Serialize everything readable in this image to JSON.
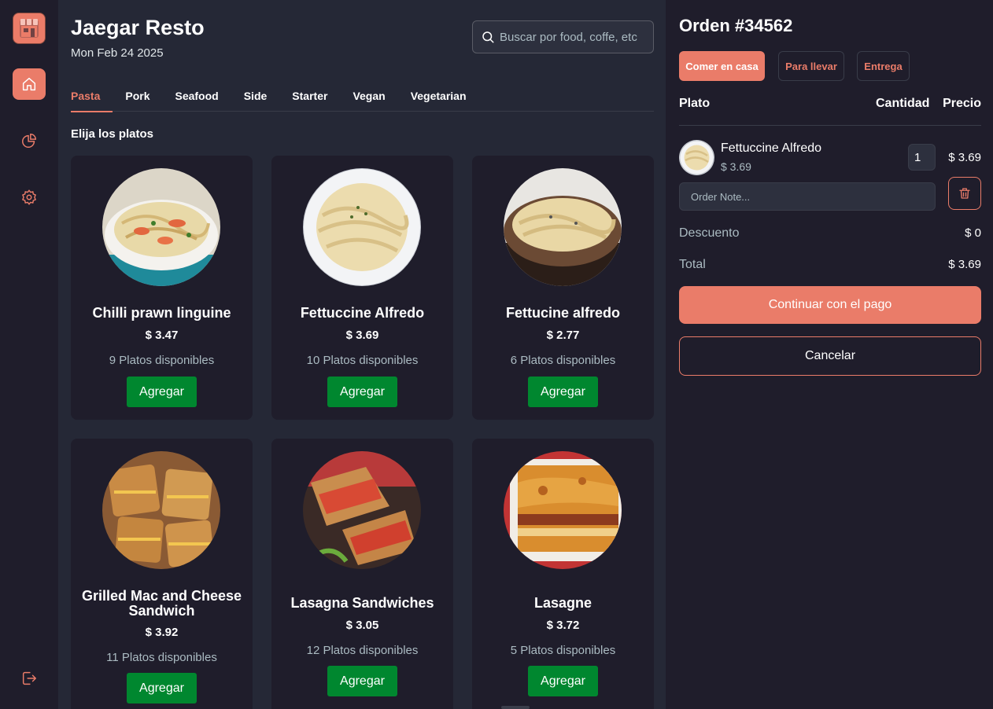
{
  "app": {
    "title": "Jaegar Resto",
    "date": "Mon Feb 24 2025"
  },
  "colors": {
    "accent": "#ea7c69",
    "add_button": "#00872f",
    "panel": "#1f1d2b",
    "background": "#252836"
  },
  "sidebar": {
    "items": [
      {
        "icon": "home-icon",
        "active": true
      },
      {
        "icon": "pie-chart-icon",
        "active": false
      },
      {
        "icon": "gear-icon",
        "active": false
      },
      {
        "icon": "logout-icon",
        "active": false
      }
    ]
  },
  "search": {
    "placeholder": "Buscar por food, coffe, etc",
    "icon": "search-icon"
  },
  "tabs": [
    {
      "label": "Pasta",
      "active": true
    },
    {
      "label": "Pork",
      "active": false
    },
    {
      "label": "Seafood",
      "active": false
    },
    {
      "label": "Side",
      "active": false
    },
    {
      "label": "Starter",
      "active": false
    },
    {
      "label": "Vegan",
      "active": false
    },
    {
      "label": "Vegetarian",
      "active": false
    }
  ],
  "menu": {
    "section_title": "Elija los platos",
    "add_label": "Agregar",
    "dishes": [
      {
        "name": "Chilli prawn linguine",
        "price": "$ 3.47",
        "stock": "9 Platos disponibles"
      },
      {
        "name": "Fettuccine Alfredo",
        "price": "$ 3.69",
        "stock": "10 Platos disponibles"
      },
      {
        "name": "Fettucine alfredo",
        "price": "$ 2.77",
        "stock": "6 Platos disponibles"
      },
      {
        "name": "Grilled Mac and Cheese Sandwich",
        "price": "$ 3.92",
        "stock": "11 Platos disponibles"
      },
      {
        "name": "Lasagna Sandwiches",
        "price": "$ 3.05",
        "stock": "12 Platos disponibles"
      },
      {
        "name": "Lasagne",
        "price": "$ 3.72",
        "stock": "5 Platos disponibles"
      }
    ]
  },
  "order": {
    "title": "Orden #34562",
    "types": [
      {
        "label": "Comer en casa",
        "active": true
      },
      {
        "label": "Para llevar",
        "active": false
      },
      {
        "label": "Entrega",
        "active": false
      }
    ],
    "columns": {
      "dish": "Plato",
      "quantity": "Cantidad",
      "price": "Precio"
    },
    "items": [
      {
        "name": "Fettuccine Alfredo",
        "unit_price": "$ 3.69",
        "quantity": "1",
        "total": "$ 3.69",
        "note_placeholder": "Order Note..."
      }
    ],
    "discount_label": "Descuento",
    "discount_value": "$ 0",
    "total_label": "Total",
    "total_value": "$ 3.69",
    "pay_label": "Continuar con el pago",
    "cancel_label": "Cancelar"
  }
}
